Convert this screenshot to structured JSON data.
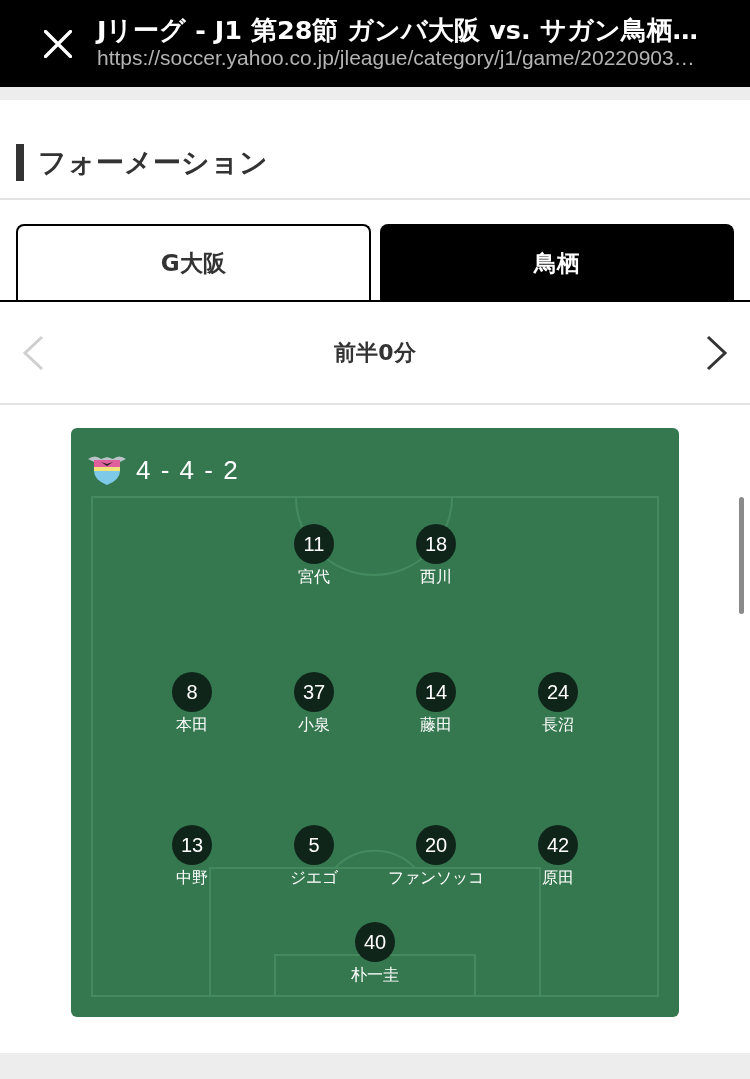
{
  "header": {
    "title": "Jリーグ - J1 第28節 ガンバ大阪 vs. サガン鳥栖…",
    "url": "https://soccer.yahoo.co.jp/jleague/category/j1/game/20220903…"
  },
  "section": {
    "title": "フォーメーション"
  },
  "tabs": [
    {
      "label": "G大阪",
      "selected": false
    },
    {
      "label": "鳥栖",
      "selected": true
    }
  ],
  "period": {
    "label": "前半0分",
    "prev": {
      "disabled": true
    },
    "next": {
      "disabled": false
    }
  },
  "formation": {
    "label": "4 - 4 - 2",
    "lines": [
      {
        "players": [
          {
            "number": "11",
            "name": "宮代"
          },
          {
            "number": "18",
            "name": "西川"
          }
        ]
      },
      {
        "players": [
          {
            "number": "8",
            "name": "本田"
          },
          {
            "number": "37",
            "name": "小泉"
          },
          {
            "number": "14",
            "name": "藤田"
          },
          {
            "number": "24",
            "name": "長沼"
          }
        ]
      },
      {
        "players": [
          {
            "number": "13",
            "name": "中野"
          },
          {
            "number": "5",
            "name": "ジエゴ"
          },
          {
            "number": "20",
            "name": "ファンソッコ"
          },
          {
            "number": "42",
            "name": "原田"
          }
        ]
      },
      {
        "players": [
          {
            "number": "40",
            "name": "朴一圭"
          }
        ]
      }
    ]
  }
}
